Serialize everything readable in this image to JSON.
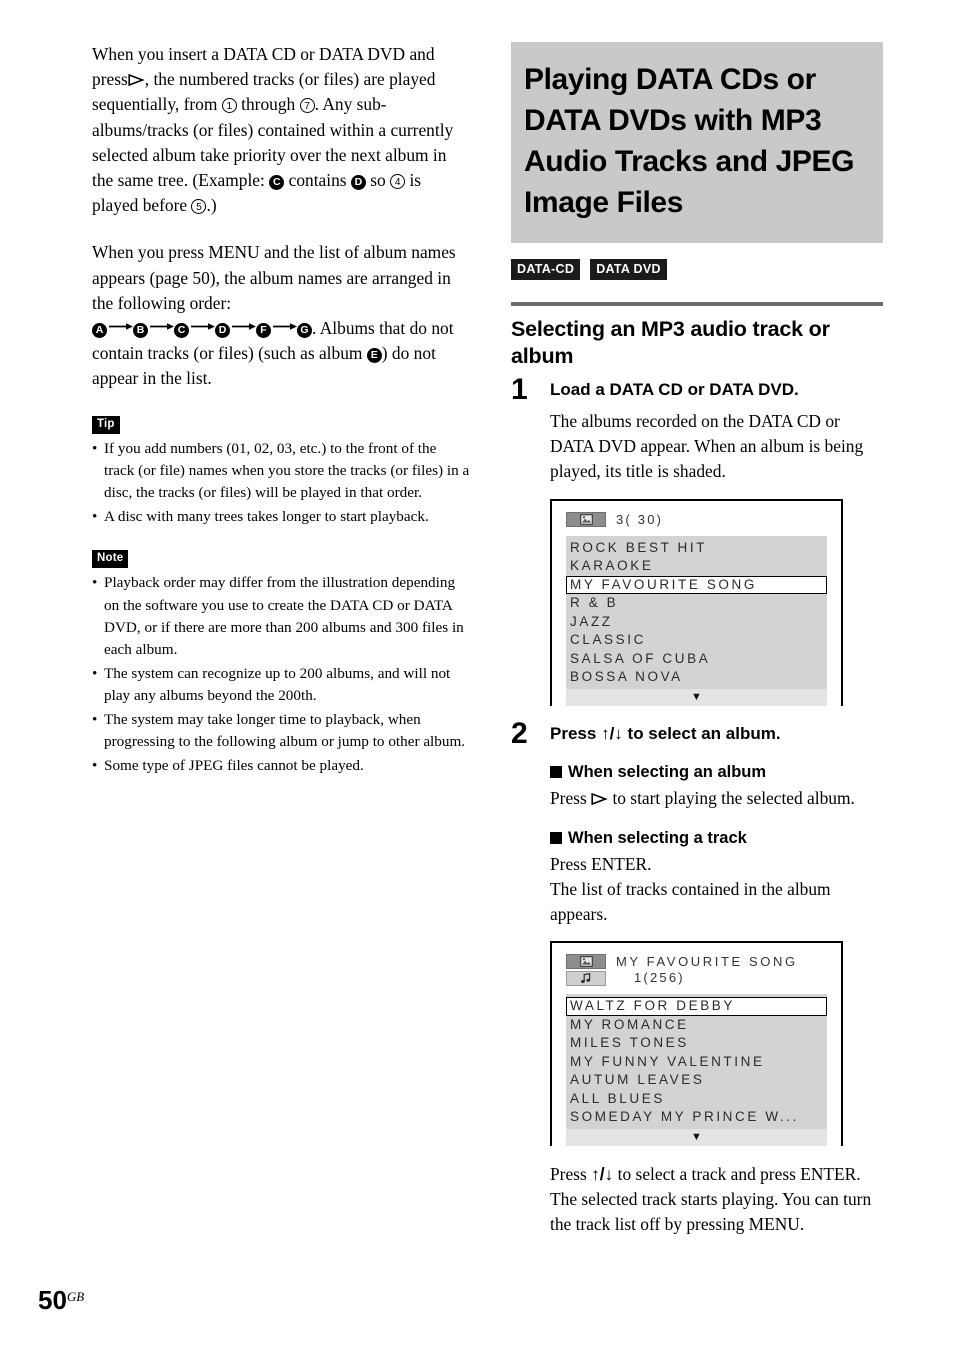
{
  "page": {
    "number": "50",
    "region_suffix": "GB"
  },
  "left_column": {
    "para1_part1": "When you insert a DATA CD or DATA DVD and press",
    "para1_part2": ", the numbered tracks (or files) are played sequentially, from",
    "para1_num_from": "1",
    "para1_part3": "through",
    "para1_num_to": "7",
    "para1_part4": ". Any sub-albums/tracks (or files) contained within a currently selected album take priority over the next album in the same tree. (Example:",
    "para1_albumC": "C",
    "para1_part5": "contains",
    "para1_albumD": "D",
    "para1_part6": "so",
    "para1_num4": "4",
    "para1_part7": "is played before",
    "para1_num5": "5",
    "para1_part8": ".)",
    "para2_part1": "When you press MENU and the list of album names appears (page 50), the album names are arranged in the following order:",
    "para2_sequence": [
      "A",
      "B",
      "C",
      "D",
      "F",
      "G"
    ],
    "para2_part2": ". Albums that do not contain tracks (or files) (such as album",
    "para2_albumE": "E",
    "para2_part3": ") do not appear in the list.",
    "tip_label": "Tip",
    "tip_items": [
      "If you add numbers (01, 02, 03, etc.) to the front of the track (or file) names when you store the tracks (or files) in a disc, the tracks (or files) will be played in that order.",
      "A disc with many trees takes longer to start playback."
    ],
    "note_label": "Note",
    "note_items": [
      "Playback order may differ from the illustration depending on the software you use to create the DATA CD or DATA DVD, or if there are more than 200 albums and 300 files in each album.",
      "The system can recognize up to 200 albums, and will not play any albums beyond the 200th.",
      "The system may take longer time to playback, when progressing to the following album or jump to other album.",
      "Some type of JPEG files cannot be played."
    ]
  },
  "right_column": {
    "chapter_title": "Playing DATA CDs or DATA DVDs with MP3 Audio Tracks and JPEG Image Files",
    "disc_badges": [
      "DATA-CD",
      "DATA DVD"
    ],
    "section_title": "Selecting an MP3 audio track or album",
    "step1": {
      "number": "1",
      "title": "Load a DATA CD or DATA DVD.",
      "body": "The albums recorded on the DATA CD or DATA DVD appear. When an album is being played, its title is shaded."
    },
    "step2": {
      "number": "2",
      "title_before": "Press",
      "title_keys": "↑/↓",
      "title_after": "to select an album.",
      "sub1_head": "When selecting an album",
      "sub1_body_before": "Press",
      "sub1_body_after": "to start playing the selected album.",
      "sub2_head": "When selecting a track",
      "sub2_body_line1": "Press ENTER.",
      "sub2_body_line2": "The list of tracks contained in the album appears."
    },
    "closing": {
      "line1_before": "Press",
      "line1_keys": "↑/↓",
      "line1_after": "to select a track and press ENTER.",
      "line2": "The selected track starts playing. You can turn the track list off by pressing MENU."
    },
    "osd_albums": {
      "header_count": "3( 30)",
      "album_icon": "image-album-icon",
      "items": [
        "ROCK BEST HIT",
        "KARAOKE",
        "MY FAVOURITE SONG",
        "R & B",
        "JAZZ",
        "CLASSIC",
        "SALSA OF CUBA",
        "BOSSA NOVA"
      ],
      "selected_index": 2,
      "scroll_indicator": "▼"
    },
    "osd_tracks": {
      "header_title": "MY FAVOURITE SONG",
      "header_count": "1(256)",
      "album_icon": "image-album-icon",
      "track_icon": "music-note-icon",
      "items": [
        "WALTZ FOR DEBBY",
        "MY ROMANCE",
        "MILES TONES",
        "MY FUNNY VALENTINE",
        "AUTUM LEAVES",
        "ALL BLUES",
        "SOMEDAY MY PRINCE W..."
      ],
      "selected_index": 0,
      "scroll_indicator": "▼"
    }
  },
  "colors": {
    "chapter_bg": "#c9c9c9",
    "rule": "#6a6a6a",
    "osd_list_bg": "#d3d3d3",
    "osd_scroll_bg": "#e4e4e4",
    "badge_bg": "#1b1b1b"
  }
}
